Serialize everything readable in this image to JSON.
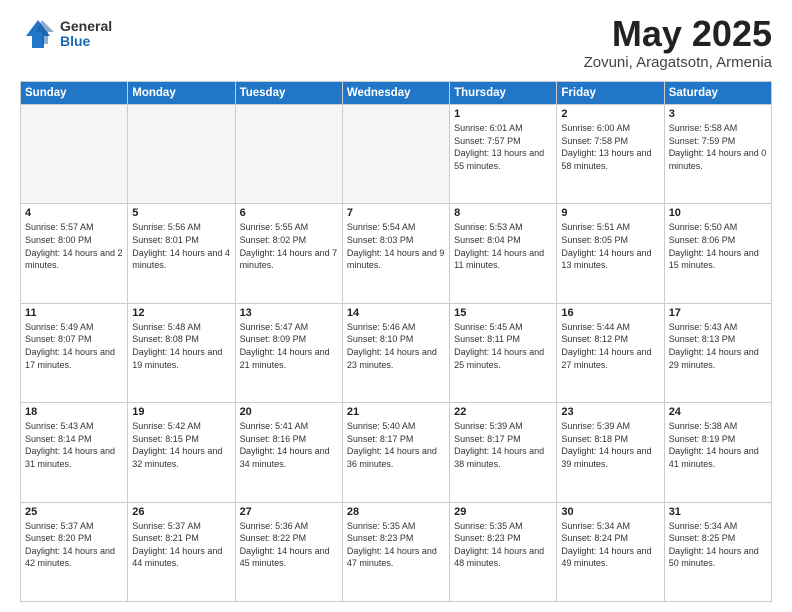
{
  "logo": {
    "general": "General",
    "blue": "Blue"
  },
  "title": {
    "month": "May 2025",
    "location": "Zovuni, Aragatsotn, Armenia"
  },
  "weekdays": [
    "Sunday",
    "Monday",
    "Tuesday",
    "Wednesday",
    "Thursday",
    "Friday",
    "Saturday"
  ],
  "weeks": [
    [
      {
        "day": "",
        "info": "",
        "empty": true
      },
      {
        "day": "",
        "info": "",
        "empty": true
      },
      {
        "day": "",
        "info": "",
        "empty": true
      },
      {
        "day": "",
        "info": "",
        "empty": true
      },
      {
        "day": "1",
        "info": "Sunrise: 6:01 AM\nSunset: 7:57 PM\nDaylight: 13 hours\nand 55 minutes.",
        "empty": false
      },
      {
        "day": "2",
        "info": "Sunrise: 6:00 AM\nSunset: 7:58 PM\nDaylight: 13 hours\nand 58 minutes.",
        "empty": false
      },
      {
        "day": "3",
        "info": "Sunrise: 5:58 AM\nSunset: 7:59 PM\nDaylight: 14 hours\nand 0 minutes.",
        "empty": false
      }
    ],
    [
      {
        "day": "4",
        "info": "Sunrise: 5:57 AM\nSunset: 8:00 PM\nDaylight: 14 hours\nand 2 minutes.",
        "empty": false
      },
      {
        "day": "5",
        "info": "Sunrise: 5:56 AM\nSunset: 8:01 PM\nDaylight: 14 hours\nand 4 minutes.",
        "empty": false
      },
      {
        "day": "6",
        "info": "Sunrise: 5:55 AM\nSunset: 8:02 PM\nDaylight: 14 hours\nand 7 minutes.",
        "empty": false
      },
      {
        "day": "7",
        "info": "Sunrise: 5:54 AM\nSunset: 8:03 PM\nDaylight: 14 hours\nand 9 minutes.",
        "empty": false
      },
      {
        "day": "8",
        "info": "Sunrise: 5:53 AM\nSunset: 8:04 PM\nDaylight: 14 hours\nand 11 minutes.",
        "empty": false
      },
      {
        "day": "9",
        "info": "Sunrise: 5:51 AM\nSunset: 8:05 PM\nDaylight: 14 hours\nand 13 minutes.",
        "empty": false
      },
      {
        "day": "10",
        "info": "Sunrise: 5:50 AM\nSunset: 8:06 PM\nDaylight: 14 hours\nand 15 minutes.",
        "empty": false
      }
    ],
    [
      {
        "day": "11",
        "info": "Sunrise: 5:49 AM\nSunset: 8:07 PM\nDaylight: 14 hours\nand 17 minutes.",
        "empty": false
      },
      {
        "day": "12",
        "info": "Sunrise: 5:48 AM\nSunset: 8:08 PM\nDaylight: 14 hours\nand 19 minutes.",
        "empty": false
      },
      {
        "day": "13",
        "info": "Sunrise: 5:47 AM\nSunset: 8:09 PM\nDaylight: 14 hours\nand 21 minutes.",
        "empty": false
      },
      {
        "day": "14",
        "info": "Sunrise: 5:46 AM\nSunset: 8:10 PM\nDaylight: 14 hours\nand 23 minutes.",
        "empty": false
      },
      {
        "day": "15",
        "info": "Sunrise: 5:45 AM\nSunset: 8:11 PM\nDaylight: 14 hours\nand 25 minutes.",
        "empty": false
      },
      {
        "day": "16",
        "info": "Sunrise: 5:44 AM\nSunset: 8:12 PM\nDaylight: 14 hours\nand 27 minutes.",
        "empty": false
      },
      {
        "day": "17",
        "info": "Sunrise: 5:43 AM\nSunset: 8:13 PM\nDaylight: 14 hours\nand 29 minutes.",
        "empty": false
      }
    ],
    [
      {
        "day": "18",
        "info": "Sunrise: 5:43 AM\nSunset: 8:14 PM\nDaylight: 14 hours\nand 31 minutes.",
        "empty": false
      },
      {
        "day": "19",
        "info": "Sunrise: 5:42 AM\nSunset: 8:15 PM\nDaylight: 14 hours\nand 32 minutes.",
        "empty": false
      },
      {
        "day": "20",
        "info": "Sunrise: 5:41 AM\nSunset: 8:16 PM\nDaylight: 14 hours\nand 34 minutes.",
        "empty": false
      },
      {
        "day": "21",
        "info": "Sunrise: 5:40 AM\nSunset: 8:17 PM\nDaylight: 14 hours\nand 36 minutes.",
        "empty": false
      },
      {
        "day": "22",
        "info": "Sunrise: 5:39 AM\nSunset: 8:17 PM\nDaylight: 14 hours\nand 38 minutes.",
        "empty": false
      },
      {
        "day": "23",
        "info": "Sunrise: 5:39 AM\nSunset: 8:18 PM\nDaylight: 14 hours\nand 39 minutes.",
        "empty": false
      },
      {
        "day": "24",
        "info": "Sunrise: 5:38 AM\nSunset: 8:19 PM\nDaylight: 14 hours\nand 41 minutes.",
        "empty": false
      }
    ],
    [
      {
        "day": "25",
        "info": "Sunrise: 5:37 AM\nSunset: 8:20 PM\nDaylight: 14 hours\nand 42 minutes.",
        "empty": false
      },
      {
        "day": "26",
        "info": "Sunrise: 5:37 AM\nSunset: 8:21 PM\nDaylight: 14 hours\nand 44 minutes.",
        "empty": false
      },
      {
        "day": "27",
        "info": "Sunrise: 5:36 AM\nSunset: 8:22 PM\nDaylight: 14 hours\nand 45 minutes.",
        "empty": false
      },
      {
        "day": "28",
        "info": "Sunrise: 5:35 AM\nSunset: 8:23 PM\nDaylight: 14 hours\nand 47 minutes.",
        "empty": false
      },
      {
        "day": "29",
        "info": "Sunrise: 5:35 AM\nSunset: 8:23 PM\nDaylight: 14 hours\nand 48 minutes.",
        "empty": false
      },
      {
        "day": "30",
        "info": "Sunrise: 5:34 AM\nSunset: 8:24 PM\nDaylight: 14 hours\nand 49 minutes.",
        "empty": false
      },
      {
        "day": "31",
        "info": "Sunrise: 5:34 AM\nSunset: 8:25 PM\nDaylight: 14 hours\nand 50 minutes.",
        "empty": false
      }
    ]
  ]
}
